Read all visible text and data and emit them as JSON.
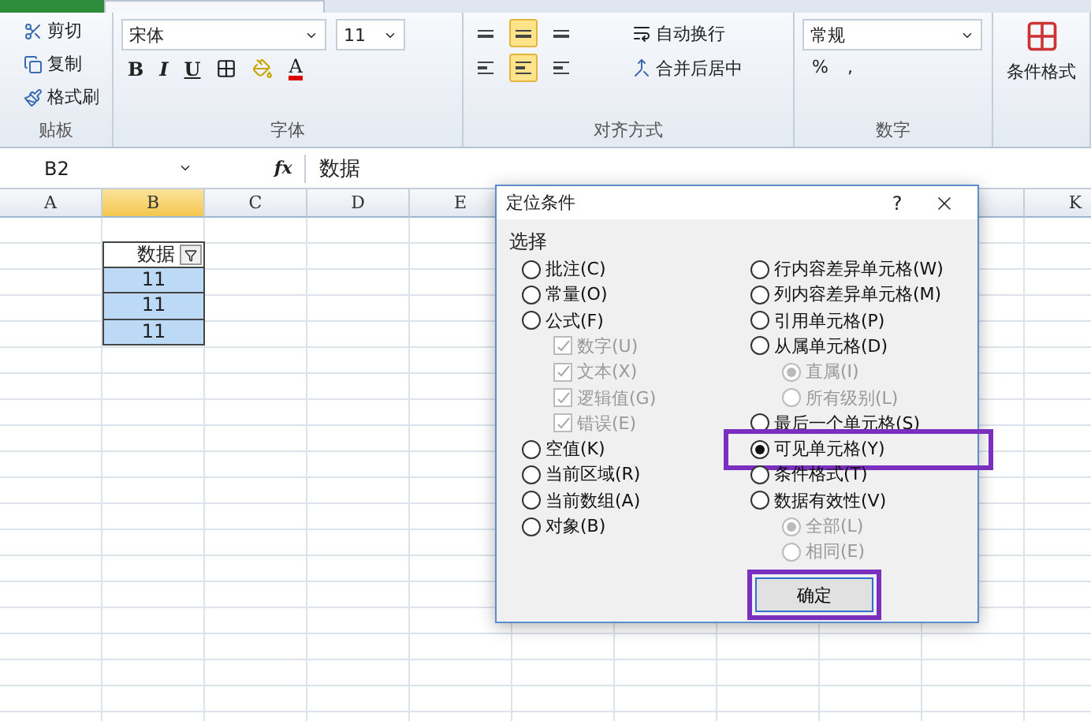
{
  "ribbon": {
    "clipboard": {
      "items": [
        {
          "label": "剪切",
          "kind": "cut"
        },
        {
          "label": "复制",
          "kind": "copy"
        },
        {
          "label": "格式刷",
          "kind": "brush"
        }
      ],
      "label": "贴板"
    },
    "font": {
      "name": "宋体",
      "size": "11",
      "styles": [
        {
          "label": "B",
          "kind": "bold"
        },
        {
          "label": "I",
          "kind": "italic"
        },
        {
          "label": "U",
          "kind": "underline"
        }
      ],
      "font_color": "A",
      "label": "字体"
    },
    "alignment": {
      "wrap": "自动换行",
      "merge": "合并后居中",
      "label": "对齐方式"
    },
    "number": {
      "format": "常规",
      "percent": "%",
      "comma": ",",
      "label": "数字"
    },
    "styles": {
      "conditional": "条件格式"
    }
  },
  "formula_bar": {
    "name_box": "B2",
    "function_symbol": "fx",
    "value": "数据"
  },
  "sheet": {
    "columns": [
      {
        "label": "A",
        "selected": false
      },
      {
        "label": "B",
        "selected": true
      },
      {
        "label": "C",
        "selected": false
      },
      {
        "label": "D",
        "selected": false
      },
      {
        "label": "E",
        "selected": false
      },
      {
        "label": "K",
        "selected": false
      }
    ],
    "table": {
      "header": "数据",
      "cells": [
        {
          "value": "11",
          "selected": true
        },
        {
          "value": "11",
          "selected": true
        },
        {
          "value": "11",
          "selected": true
        }
      ]
    }
  },
  "dialog": {
    "title": "定位条件",
    "help": "?",
    "group": "选择",
    "left": [
      {
        "kind": "radio",
        "label": "批注(C)",
        "selected": false,
        "disabled": false
      },
      {
        "kind": "radio",
        "label": "常量(O)",
        "selected": false,
        "disabled": false
      },
      {
        "kind": "radio",
        "label": "公式(F)",
        "selected": false,
        "disabled": false,
        "children": [
          {
            "kind": "checkbox",
            "label": "数字(U)",
            "checked": true,
            "disabled": true
          },
          {
            "kind": "checkbox",
            "label": "文本(X)",
            "checked": true,
            "disabled": true
          },
          {
            "kind": "checkbox",
            "label": "逻辑值(G)",
            "checked": true,
            "disabled": true
          },
          {
            "kind": "checkbox",
            "label": "错误(E)",
            "checked": true,
            "disabled": true
          }
        ]
      },
      {
        "kind": "radio",
        "label": "空值(K)",
        "selected": false,
        "disabled": false
      },
      {
        "kind": "radio",
        "label": "当前区域(R)",
        "selected": false,
        "disabled": false
      },
      {
        "kind": "radio",
        "label": "当前数组(A)",
        "selected": false,
        "disabled": false
      },
      {
        "kind": "radio",
        "label": "对象(B)",
        "selected": false,
        "disabled": false
      }
    ],
    "right": [
      {
        "kind": "radio",
        "label": "行内容差异单元格(W)",
        "selected": false,
        "disabled": false
      },
      {
        "kind": "radio",
        "label": "列内容差异单元格(M)",
        "selected": false,
        "disabled": false
      },
      {
        "kind": "radio",
        "label": "引用单元格(P)",
        "selected": false,
        "disabled": false
      },
      {
        "kind": "radio",
        "label": "从属单元格(D)",
        "selected": false,
        "disabled": false,
        "children": [
          {
            "kind": "radio",
            "label": "直属(I)",
            "selected": true,
            "disabled": true
          },
          {
            "kind": "radio",
            "label": "所有级别(L)",
            "selected": false,
            "disabled": true
          }
        ]
      },
      {
        "kind": "radio",
        "label": "最后一个单元格(S)",
        "selected": false,
        "disabled": false
      },
      {
        "kind": "radio",
        "label": "可见单元格(Y)",
        "selected": true,
        "disabled": false,
        "highlighted": true
      },
      {
        "kind": "radio",
        "label": "条件格式(T)",
        "selected": false,
        "disabled": false
      },
      {
        "kind": "radio",
        "label": "数据有效性(V)",
        "selected": false,
        "disabled": false,
        "children": [
          {
            "kind": "radio",
            "label": "全部(L)",
            "selected": true,
            "disabled": true
          },
          {
            "kind": "radio",
            "label": "相同(E)",
            "selected": false,
            "disabled": true
          }
        ]
      }
    ],
    "buttons": [
      {
        "label": "确定",
        "highlighted": true
      }
    ]
  }
}
